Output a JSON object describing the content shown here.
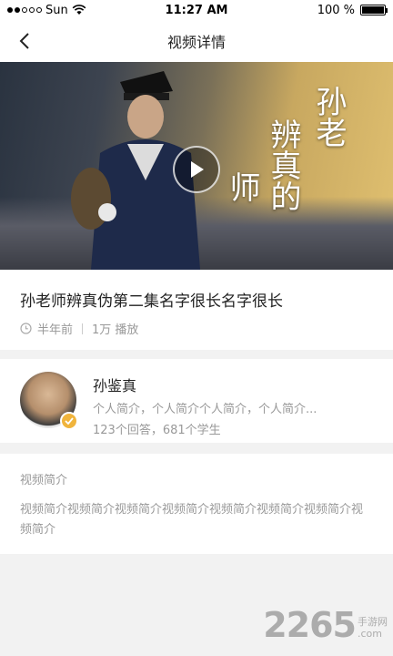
{
  "status_bar": {
    "carrier": "Sun",
    "time": "11:27 AM",
    "battery_text": "100 %",
    "battery_level": 1.0
  },
  "nav": {
    "title": "视频详情"
  },
  "video": {
    "overlay_text": [
      "孙老",
      "辨师",
      "真的"
    ],
    "overlay_col1": "孙老",
    "overlay_col2": "辨真的",
    "overlay_col3": "师"
  },
  "title_card": {
    "title": "孙老师辨真伪第二集名字很长名字很长",
    "time_ago": "半年前",
    "plays": "1万 播放"
  },
  "author": {
    "name": "孙鉴真",
    "intro": "个人简介，个人简介个人简介，个人简介...",
    "stats": "123个回答，681个学生"
  },
  "description": {
    "heading": "视频简介",
    "body": "视频简介视频简介视频简介视频简介视频简介视频简介视频简介视频简介"
  },
  "watermark": {
    "number": "2265",
    "site_cn": "手游网",
    "site_en": ".com"
  },
  "colors": {
    "badge": "#f0b43c",
    "secondary_text": "#999999"
  }
}
